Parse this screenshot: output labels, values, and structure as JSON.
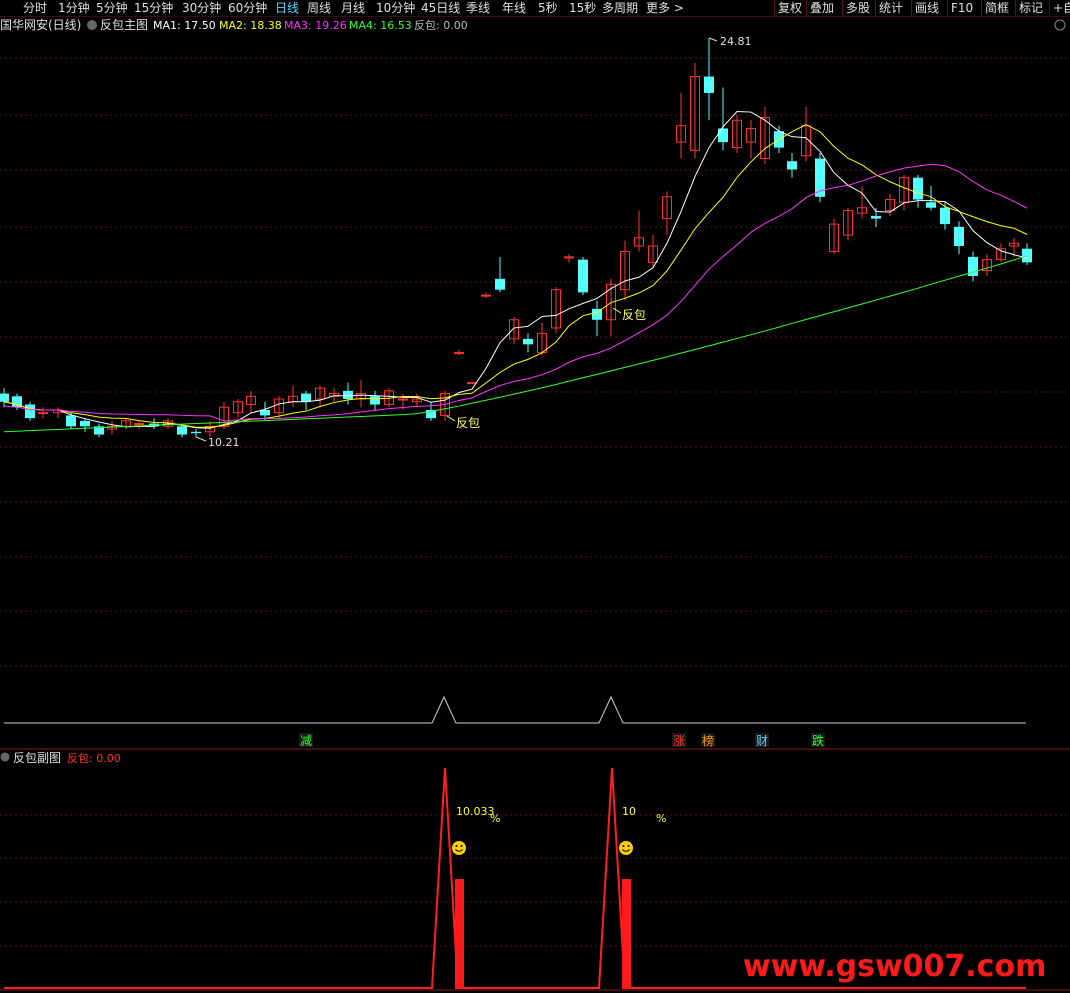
{
  "toolbar": {
    "periods": [
      "分时",
      "1分钟",
      "5分钟",
      "15分钟",
      "30分钟",
      "60分钟",
      "日线",
      "周线",
      "月线",
      "10分钟",
      "45日线",
      "季线",
      "年线",
      "5秒",
      "15秒",
      "多周期",
      "更多 >"
    ],
    "active_period": "日线",
    "tools": [
      "复权",
      "叠加",
      "多股",
      "统计",
      "画线",
      "F10",
      "简框",
      "标记",
      "+自"
    ]
  },
  "main_chart": {
    "stock_title": "国华网安(日线)",
    "indicator_name": "反包主图",
    "ma": [
      {
        "label": "MA1: 17.50",
        "color": "#ffffff"
      },
      {
        "label": "MA2: 18.38",
        "color": "#ffff00"
      },
      {
        "label": "MA3: 19.26",
        "color": "#ff33ff"
      },
      {
        "label": "MA4: 16.53",
        "color": "#33ff33"
      }
    ],
    "extra_label": "反包: 0.00",
    "colors": {
      "up": "#ff3232",
      "down": "#54ffff",
      "ma1": "#ffffff",
      "ma2": "#ffff00",
      "ma3": "#ff33ff",
      "ma4": "#33ff33"
    },
    "high_label": "24.81",
    "low_label": "10.21",
    "signal_labels": [
      "反包",
      "反包"
    ],
    "marker_labels": [
      {
        "text": "减",
        "color": "#33ff33"
      },
      {
        "text": "涨",
        "color": "#ff3232"
      },
      {
        "text": "榜",
        "color": "#ff9900"
      },
      {
        "text": "财",
        "color": "#4fd6ff"
      },
      {
        "text": "跌",
        "color": "#33ff33"
      }
    ]
  },
  "sub_chart": {
    "indicator_name": "反包副图",
    "value_label": "反包: 0.00",
    "annotations": [
      {
        "value": "10.033",
        "pct": "%"
      },
      {
        "value": "10",
        "pct": "%"
      }
    ],
    "smiley": "☻"
  },
  "watermark": "www.gsw007.com"
}
